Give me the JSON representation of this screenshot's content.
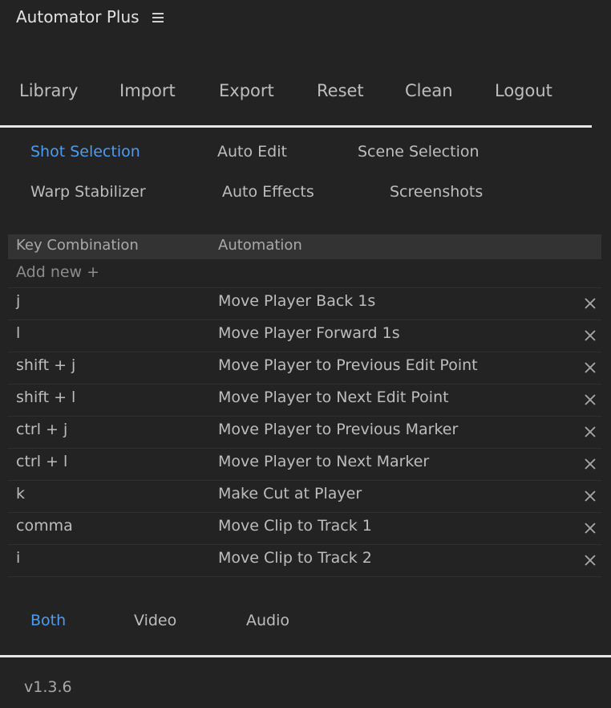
{
  "app": {
    "title": "Automator Plus"
  },
  "nav": {
    "items": [
      {
        "label": "Library"
      },
      {
        "label": "Import"
      },
      {
        "label": "Export"
      },
      {
        "label": "Reset"
      },
      {
        "label": "Clean"
      },
      {
        "label": "Logout"
      }
    ]
  },
  "feature_tabs": [
    {
      "label": "Shot Selection",
      "active": true
    },
    {
      "label": "Auto Edit",
      "active": false
    },
    {
      "label": "Scene Selection",
      "active": false
    },
    {
      "label": "Warp Stabilizer",
      "active": false
    },
    {
      "label": "Auto Effects",
      "active": false
    },
    {
      "label": "Screenshots",
      "active": false
    }
  ],
  "table": {
    "headers": {
      "key": "Key Combination",
      "automation": "Automation"
    },
    "add_label": "Add new +",
    "rows": [
      {
        "key": "j",
        "automation": "Move Player Back 1s"
      },
      {
        "key": "l",
        "automation": "Move Player Forward 1s"
      },
      {
        "key": "shift + j",
        "automation": "Move Player to Previous Edit Point"
      },
      {
        "key": "shift + l",
        "automation": "Move Player to Next Edit Point"
      },
      {
        "key": "ctrl + j",
        "automation": "Move Player to Previous Marker"
      },
      {
        "key": "ctrl + l",
        "automation": "Move Player to Next Marker"
      },
      {
        "key": "k",
        "automation": "Make Cut at Player"
      },
      {
        "key": "comma",
        "automation": "Move Clip to Track 1"
      },
      {
        "key": "i",
        "automation": "Move Clip to Track 2"
      }
    ]
  },
  "media_filter": [
    {
      "label": "Both",
      "active": true
    },
    {
      "label": "Video",
      "active": false
    },
    {
      "label": "Audio",
      "active": false
    }
  ],
  "footer": {
    "version": "v1.3.6"
  },
  "colors": {
    "background": "#232323",
    "accent": "#4b9cf2",
    "header_row": "#333333",
    "divider": "#e6e6e6"
  },
  "icons": {
    "menu": "hamburger-menu-icon",
    "delete": "close-icon"
  }
}
